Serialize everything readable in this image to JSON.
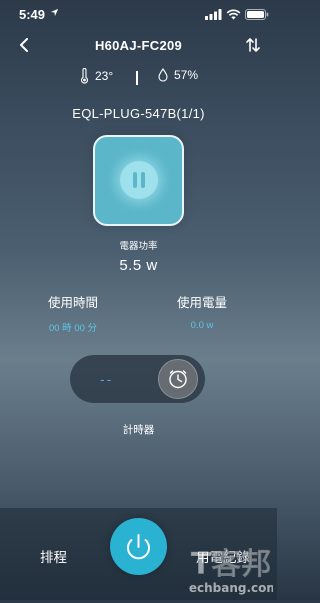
{
  "status": {
    "time": "5:49",
    "back_app": "",
    "icons": [
      "location-arrow-icon",
      "signal-bars-icon",
      "wifi-icon",
      "battery-icon"
    ]
  },
  "nav": {
    "title": "H60AJ-FC209",
    "back_icon": "chevron-left-icon",
    "swap_icon": "swap-arrows-icon"
  },
  "environment": {
    "temperature": "23°",
    "humidity": "57%",
    "temperature_icon": "thermometer-icon",
    "humidity_icon": "droplet-icon"
  },
  "device": {
    "name": "EQL-PLUG-547B(1/1)",
    "power_state_icon": "pause-icon",
    "power_label": "電器功率",
    "power_value": "5.5 w"
  },
  "stats": {
    "usage_time_label": "使用時間",
    "usage_time_value": "00 時 00 分",
    "usage_power_label": "使用電量",
    "usage_power_value": "0.0 w"
  },
  "timer": {
    "value": "--",
    "icon": "clock-icon",
    "label": "計時器"
  },
  "bottom": {
    "schedule_label": "排程",
    "power_button_icon": "power-icon",
    "history_label": "用電紀錄"
  },
  "watermark": {
    "text": "T客邦",
    "domain": "techbang.com"
  },
  "colors": {
    "card": "#5ab6c8",
    "accent": "#2ab2d2",
    "value_blue": "#5ec6e8"
  }
}
